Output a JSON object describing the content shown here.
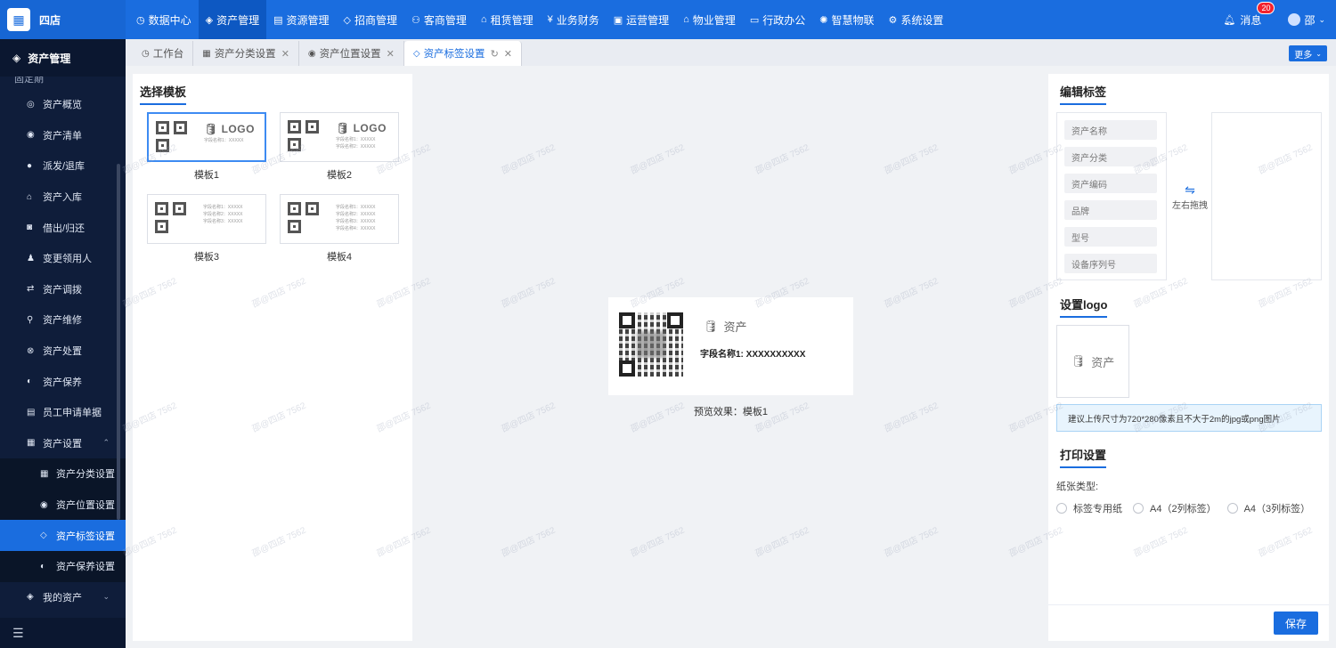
{
  "brand": {
    "name": "四店",
    "logo_icon": "building-icon"
  },
  "topnav": {
    "items": [
      {
        "label": "数据中心",
        "icon": "dashboard-icon",
        "active": false
      },
      {
        "label": "资产管理",
        "icon": "cube-icon",
        "active": true
      },
      {
        "label": "资源管理",
        "icon": "doc-icon",
        "active": false
      },
      {
        "label": "招商管理",
        "icon": "tag-icon",
        "active": false
      },
      {
        "label": "客商管理",
        "icon": "users-icon",
        "active": false
      },
      {
        "label": "租赁管理",
        "icon": "home-icon",
        "active": false
      },
      {
        "label": "业务财务",
        "icon": "finance-icon",
        "active": false
      },
      {
        "label": "运营管理",
        "icon": "ops-icon",
        "active": false
      },
      {
        "label": "物业管理",
        "icon": "house-icon",
        "active": false
      },
      {
        "label": "行政办公",
        "icon": "monitor-icon",
        "active": false
      },
      {
        "label": "智慧物联",
        "icon": "iot-icon",
        "active": false
      },
      {
        "label": "系统设置",
        "icon": "gear-icon",
        "active": false
      }
    ],
    "messages_label": "消息",
    "messages_count": "20",
    "user_label": "邵"
  },
  "sidebar": {
    "title": "资产管理",
    "partial_label": "固定期",
    "items": [
      {
        "label": "资产概览",
        "icon": "overview-icon",
        "sub": false,
        "active": false
      },
      {
        "label": "资产清单",
        "icon": "list-icon",
        "sub": false,
        "active": false
      },
      {
        "label": "派发/退库",
        "icon": "dispatch-icon",
        "sub": false,
        "active": false
      },
      {
        "label": "资产入库",
        "icon": "storage-icon",
        "sub": false,
        "active": false
      },
      {
        "label": "借出/归还",
        "icon": "lend-icon",
        "sub": false,
        "active": false
      },
      {
        "label": "变更领用人",
        "icon": "person-icon",
        "sub": false,
        "active": false
      },
      {
        "label": "资产调拨",
        "icon": "transfer-icon",
        "sub": false,
        "active": false
      },
      {
        "label": "资产维修",
        "icon": "repair-icon",
        "sub": false,
        "active": false
      },
      {
        "label": "资产处置",
        "icon": "dispose-icon",
        "sub": false,
        "active": false
      },
      {
        "label": "资产保养",
        "icon": "maintain-icon",
        "sub": false,
        "active": false
      },
      {
        "label": "员工申请单据",
        "icon": "form-icon",
        "sub": false,
        "active": false
      },
      {
        "label": "资产设置",
        "icon": "settings-icon",
        "sub": false,
        "active": false,
        "caret": "⌃"
      },
      {
        "label": "资产分类设置",
        "icon": "category-icon",
        "sub": true,
        "active": false
      },
      {
        "label": "资产位置设置",
        "icon": "location-icon",
        "sub": true,
        "active": false
      },
      {
        "label": "资产标签设置",
        "icon": "tag-icon",
        "sub": true,
        "active": true
      },
      {
        "label": "资产保养设置",
        "icon": "maintain-icon",
        "sub": true,
        "active": false
      },
      {
        "label": "我的资产",
        "icon": "cube-icon",
        "sub": false,
        "active": false,
        "caret": "⌄"
      }
    ]
  },
  "tabs": [
    {
      "label": "工作台",
      "icon": "dashboard-icon",
      "closable": false,
      "active": false
    },
    {
      "label": "资产分类设置",
      "icon": "category-icon",
      "closable": true,
      "active": false
    },
    {
      "label": "资产位置设置",
      "icon": "location-icon",
      "closable": true,
      "active": false
    },
    {
      "label": "资产标签设置",
      "icon": "tag-icon",
      "closable": true,
      "active": true
    }
  ],
  "more_label": "更多",
  "templates": {
    "title": "选择模板",
    "items": [
      {
        "label": "模板1",
        "logo": "LOGO",
        "lines": [
          "字段名称1：XXXXX"
        ],
        "selected": true
      },
      {
        "label": "模板2",
        "logo": "LOGO",
        "lines": [
          "字段名称1：XXXXX",
          "字段名称2：XXXXX"
        ],
        "selected": false
      },
      {
        "label": "模板3",
        "logo": "",
        "lines": [
          "字段名称1：XXXXX",
          "字段名称2：XXXXX",
          "字段名称3：XXXXX"
        ],
        "selected": false
      },
      {
        "label": "模板4",
        "logo": "",
        "lines": [
          "字段名称1：XXXXX",
          "字段名称2：XXXXX",
          "字段名称3：XXXXX",
          "字段名称4：XXXXX"
        ],
        "selected": false
      }
    ]
  },
  "preview": {
    "logo_text": "资产",
    "field_text": "字段名称1:   XXXXXXXXXX",
    "caption": "预览效果：模板1"
  },
  "edit": {
    "title": "编辑标签",
    "fields": [
      "资产名称",
      "资产分类",
      "资产编码",
      "品牌",
      "型号",
      "设备序列号"
    ],
    "swap_label": "左右拖拽"
  },
  "logo_section": {
    "title": "设置logo",
    "logo_text": "资产",
    "hint": "建议上传尺寸为720*280像素且不大于2m的jpg或png图片"
  },
  "print": {
    "title": "打印设置",
    "paper_label": "纸张类型:",
    "options": [
      "标签专用纸",
      "A4（2列标签）",
      "A4（3列标签）"
    ]
  },
  "save_label": "保存",
  "watermark": "邵@四店 7562",
  "colors": {
    "primary": "#1a6ddf",
    "sidebar_bg": "#0f1d3a"
  }
}
